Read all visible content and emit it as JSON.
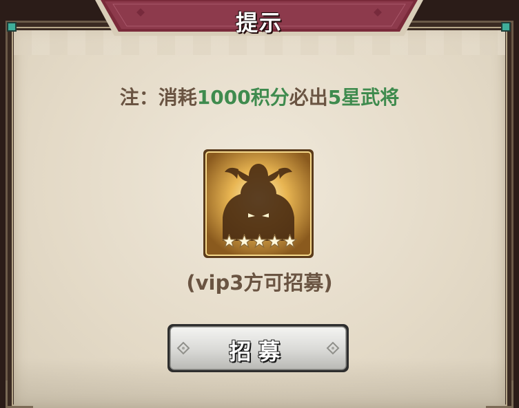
{
  "dialog": {
    "title": "提示",
    "note_prefix": "注：消耗",
    "note_points": "1000积分",
    "note_middle": "必出",
    "note_star": "5星武将",
    "vip_requirement": "(vip3方可招募)",
    "hero_card": {
      "icon": "general-silhouette-icon",
      "star_rating": 5,
      "max_stars": 5
    },
    "button_label": "招募"
  },
  "colors": {
    "highlight": "#3f8b4e",
    "body_text": "#6a5442",
    "accent_gem": "#3fae9a"
  }
}
